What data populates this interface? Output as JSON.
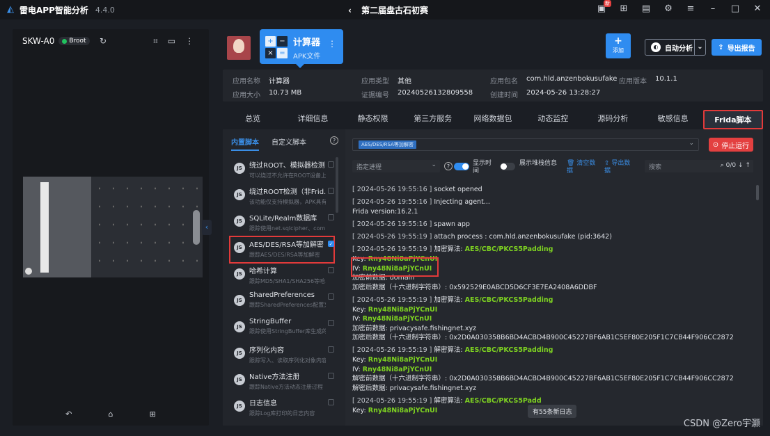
{
  "titlebar": {
    "app_name": "雷电APP智能分析",
    "version": "4.4.0",
    "project": "第二届盘古石初赛",
    "badge": "新"
  },
  "device": {
    "name": "SKW-A0",
    "root": "Broot"
  },
  "app_card": {
    "title": "计算器",
    "subtitle": "APK文件"
  },
  "toolbar": {
    "add_label": "添加",
    "auto_label": "自动分析",
    "export_label": "导出报告"
  },
  "info": {
    "name_k": "应用名称",
    "name_v": "计算器",
    "size_k": "应用大小",
    "size_v": "10.73 MB",
    "type_k": "应用类型",
    "type_v": "其他",
    "cert_k": "证据编号",
    "cert_v": "20240526132809558",
    "pkg_k": "应用包名",
    "pkg_v": "com.hld.anzenbokusufake",
    "time_k": "创建时间",
    "time_v": "2024-05-26 13:28:27",
    "ver_k": "应用版本",
    "ver_v": "10.1.1"
  },
  "tabs": [
    "总览",
    "详细信息",
    "静态权限",
    "第三方服务",
    "网络数据包",
    "动态监控",
    "源码分析",
    "敏感信息",
    "Frida脚本"
  ],
  "scripts": {
    "tab_builtin": "内置脚本",
    "tab_custom": "自定义脚本",
    "items": [
      {
        "name": "绕过ROOT、模拟器检测",
        "desc": "可以绕过不允许在ROOT设备上..."
      },
      {
        "name": "绕过ROOT检测（非Frid...",
        "desc": "该功能仅支持模拟器，APK具有..."
      },
      {
        "name": "SQLite/Realm数据库",
        "desc": "跟踪使用net.sqlcipher、com.t..."
      },
      {
        "name": "AES/DES/RSA等加解密",
        "desc": "跟踪AES/DES/RSA等加解密"
      },
      {
        "name": "哈希计算",
        "desc": "跟踪MD5/SHA1/SHA256等哈..."
      },
      {
        "name": "SharedPreferences",
        "desc": "跟踪SharedPreferences配置文..."
      },
      {
        "name": "StringBuffer",
        "desc": "跟踪使用StringBuffer库生成的..."
      },
      {
        "name": "序列化内容",
        "desc": "跟踪写入、读取序列化对象内容"
      },
      {
        "name": "Native方法注册",
        "desc": "跟踪Native方法动态注册过程"
      },
      {
        "name": "日志信息",
        "desc": "跟踪Log库打印的日志内容"
      }
    ]
  },
  "log_pane": {
    "selected_script": "AES/DES/RSA等加解密",
    "stop_label": "停止运行",
    "process_placeholder": "指定进程",
    "show_time": "显示时间",
    "show_stack": "展示堆栈信息",
    "clear": "清空数据",
    "export": "导出数据",
    "search_placeholder": "搜索",
    "count": "0/0",
    "new_logs": "有55条新日志",
    "lines": [
      {
        "ts": "[ 2024-05-26 19:55:16 ]",
        "text": "socket opened"
      },
      {
        "ts": "[ 2024-05-26 19:55:16 ]",
        "text": "Injecting agent..."
      },
      {
        "text": "Frida version:16.2.1"
      },
      {
        "ts": "[ 2024-05-26 19:55:16 ]",
        "text": "spawn app"
      },
      {
        "ts": "[ 2024-05-26 19:55:19 ]",
        "text": "attach process : com.hld.anzenbokusufake (pid:3642)"
      },
      {
        "ts": "[ 2024-05-26 19:55:19 ]",
        "text": "加密算法:",
        "hl": "AES/CBC/PKCS5Padding"
      },
      {
        "text": "Key:",
        "hl": "Rny48Ni8aPjYCnUI"
      },
      {
        "text": "IV:",
        "hl": "Rny48Ni8aPjYCnUI"
      },
      {
        "text": "加密前数据: domain"
      },
      {
        "text": "加密后数据（十六进制字符串）: 0x592529E0ABCD5D6CF3E7EA2408A6DDBF"
      },
      {
        "ts": "[ 2024-05-26 19:55:19 ]",
        "text": "加密算法:",
        "hl": "AES/CBC/PKCS5Padding"
      },
      {
        "text": "Key:",
        "hl": "Rny48Ni8aPjYCnUI"
      },
      {
        "text": "IV:",
        "hl": "Rny48Ni8aPjYCnUI"
      },
      {
        "text": "加密前数据: privacysafe.fishingnet.xyz"
      },
      {
        "text": "加密后数据（十六进制字符串）: 0x2D0A030358B6BD4ACBD4B900C45227BF6AB1C5EF80E205F1C7CB44F906CC2872"
      },
      {
        "ts": "[ 2024-05-26 19:55:19 ]",
        "text": "解密算法:",
        "hl": "AES/CBC/PKCS5Padding"
      },
      {
        "text": "Key:",
        "hl": "Rny48Ni8aPjYCnUI"
      },
      {
        "text": "IV:",
        "hl": "Rny48Ni8aPjYCnUI"
      },
      {
        "text": "解密前数据（十六进制字符串）: 0x2D0A030358B6BD4ACBD4B900C45227BF6AB1C5EF80E205F1C7CB44F906CC2872"
      },
      {
        "text": "解密后数据: privacysafe.fishingnet.xyz"
      },
      {
        "ts": "[ 2024-05-26 19:55:19 ]",
        "text": "解密算法:",
        "hl": "AES/CBC/PKCS5Padd"
      },
      {
        "text": "Key:",
        "hl": "Rny48Ni8aPjYCnUI"
      }
    ]
  },
  "watermark": "CSDN @Zero宇灏",
  "colors": {
    "accent": "#2f8cf0",
    "danger": "#e34040",
    "highlight": "#7ed321"
  }
}
